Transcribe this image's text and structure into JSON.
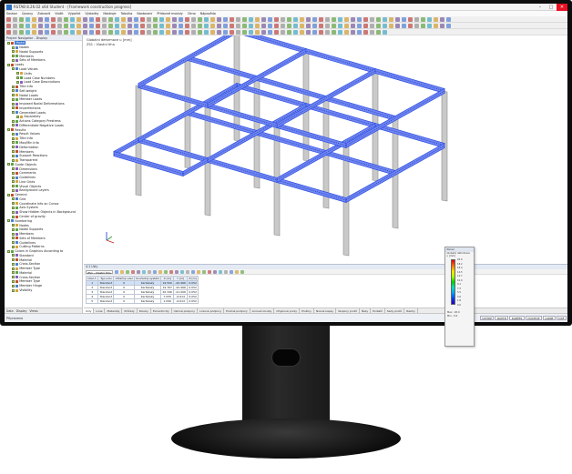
{
  "window": {
    "title": "RSTAB 8.26.02 x64 Student - [Framework construction progress]",
    "min": "–",
    "max": "□",
    "close": "✕"
  },
  "menu": [
    "Soubor",
    "Úpravy",
    "Zobrazit",
    "Vložit",
    "Výpočet",
    "Výsledky",
    "Nástroje",
    "Tabulka",
    "Nastavení",
    "Přídavné moduly",
    "Okno",
    "Nápověda"
  ],
  "navigator": {
    "title": "Project Navigator - Display",
    "items": [
      {
        "label": "Model",
        "depth": 0,
        "selected": true
      },
      {
        "label": "Nodes",
        "depth": 1
      },
      {
        "label": "Nodal Supports",
        "depth": 1
      },
      {
        "label": "Members",
        "depth": 1
      },
      {
        "label": "Sets of Members",
        "depth": 1
      },
      {
        "label": "Loads",
        "depth": 0
      },
      {
        "label": "Load Values",
        "depth": 1
      },
      {
        "label": "Units",
        "depth": 2
      },
      {
        "label": "Load Case Numbers",
        "depth": 2
      },
      {
        "label": "Load Case Descriptions",
        "depth": 2
      },
      {
        "label": "Title Info",
        "depth": 1
      },
      {
        "label": "Self-weight",
        "depth": 1
      },
      {
        "label": "Nodal Loads",
        "depth": 1
      },
      {
        "label": "Member Loads",
        "depth": 1
      },
      {
        "label": "Imposed Nodal Deformations",
        "depth": 1
      },
      {
        "label": "Imperfections",
        "depth": 1
      },
      {
        "label": "Generated Loads",
        "depth": 1
      },
      {
        "label": "Separately",
        "depth": 2
      },
      {
        "label": "Actions Category Prestress",
        "depth": 1
      },
      {
        "label": "Differentiate Negative Loads",
        "depth": 1
      },
      {
        "label": "Results",
        "depth": 0
      },
      {
        "label": "Result Values",
        "depth": 1
      },
      {
        "label": "Title Info",
        "depth": 1
      },
      {
        "label": "Max/Min Info",
        "depth": 1
      },
      {
        "label": "Deformation",
        "depth": 1
      },
      {
        "label": "Members",
        "depth": 1
      },
      {
        "label": "Support Reactions",
        "depth": 1
      },
      {
        "label": "Transparent",
        "depth": 1
      },
      {
        "label": "Guide Objects",
        "depth": 0
      },
      {
        "label": "Dimensions",
        "depth": 1
      },
      {
        "label": "Comments",
        "depth": 1
      },
      {
        "label": "Guidelines",
        "depth": 1
      },
      {
        "label": "Line Grids",
        "depth": 1
      },
      {
        "label": "Visual Objects",
        "depth": 1
      },
      {
        "label": "Background Layers",
        "depth": 1
      },
      {
        "label": "General",
        "depth": 0
      },
      {
        "label": "Grid",
        "depth": 1
      },
      {
        "label": "Coordinate Info on Cursor",
        "depth": 1
      },
      {
        "label": "Axis System",
        "depth": 1
      },
      {
        "label": "Show Hidden Objects in Background",
        "depth": 1
      },
      {
        "label": "Center of gravity",
        "depth": 1
      },
      {
        "label": "Numbering",
        "depth": 0
      },
      {
        "label": "Nodes",
        "depth": 1
      },
      {
        "label": "Nodal Supports",
        "depth": 1
      },
      {
        "label": "Members",
        "depth": 1
      },
      {
        "label": "Sets of Members",
        "depth": 1
      },
      {
        "label": "Guidelines",
        "depth": 1
      },
      {
        "label": "Cutting Patterns",
        "depth": 1
      },
      {
        "label": "Colors in Graphics According to",
        "depth": 0
      },
      {
        "label": "Standard",
        "depth": 1
      },
      {
        "label": "Material",
        "depth": 1
      },
      {
        "label": "Cross-Section",
        "depth": 1
      },
      {
        "label": "Member Type",
        "depth": 1
      },
      {
        "label": "Material",
        "depth": 1
      },
      {
        "label": "Cross-Section",
        "depth": 1
      },
      {
        "label": "Member Type",
        "depth": 1
      },
      {
        "label": "Member Hinge",
        "depth": 1
      },
      {
        "label": "Visibility",
        "depth": 1
      }
    ],
    "tabs": [
      "Data",
      "Display",
      "Views"
    ]
  },
  "viewport": {
    "caption_line1": "Globální deformace u [mm]",
    "caption_line2": "ZS1 : Vlastní tíha"
  },
  "table": {
    "title": "4.1 Uzly",
    "toolbar_select": "ZS1 - Vlastní tíha",
    "headers": [
      "Uzel č.",
      "Typ uzlu",
      "Vztažný uzel",
      "Souřadný systém",
      "X [m]",
      "Y [m]",
      "Z [m]"
    ],
    "rows": [
      [
        "1",
        "Standard",
        "0",
        "Kartézský",
        "19.500",
        "-20.966",
        "0.052"
      ],
      [
        "2",
        "Standard",
        "0",
        "Kartézský",
        "19.767",
        "-20.966",
        "0.052"
      ],
      [
        "3",
        "Standard",
        "0",
        "Kartézský",
        "20.346",
        "-21.006",
        "0.052"
      ],
      [
        "4",
        "Standard",
        "0",
        "Kartézský",
        "7.055",
        "-6.614",
        "0.052"
      ],
      [
        "5",
        "Standard",
        "0",
        "Kartézský",
        "1.090",
        "-6.614",
        "0.052"
      ]
    ],
    "sheet_tabs": [
      "Uzly",
      "Linie",
      "Materiály",
      "Průřezy",
      "Klouby",
      "Excentricity",
      "Uzlové podpory",
      "Liniové podpory",
      "Pružné podpory",
      "Liniové klouby",
      "Ohybové prvky",
      "Pružiny",
      "Nosné kapsy",
      "Skupiny prutů",
      "Řezy",
      "Podlaží",
      "Sady prutů",
      "Rastry"
    ]
  },
  "statusbar": {
    "text": "Připraveno",
    "buttons": [
      "UCHOP",
      "RASTR",
      "KARTES",
      "OUCHOP",
      "GLINE",
      "DXF"
    ]
  },
  "legend": {
    "title": "Panel",
    "subtitle1": "Globální deformace",
    "subtitle2": "u [mm]",
    "values": [
      "20.0",
      "18.2",
      "16.4",
      "14.5",
      "12.7",
      "10.9",
      "9.1",
      "7.3",
      "5.5",
      "3.6",
      "1.8",
      "0.0"
    ],
    "max_label": "Max : 20.0",
    "min_label": "Min : 0.0"
  },
  "colors": {
    "beam_blue": "#2f4fe0",
    "beam_fill": "#6f86f3",
    "column_gray": "#c9c9c9",
    "accent": "#2f6fd0"
  }
}
